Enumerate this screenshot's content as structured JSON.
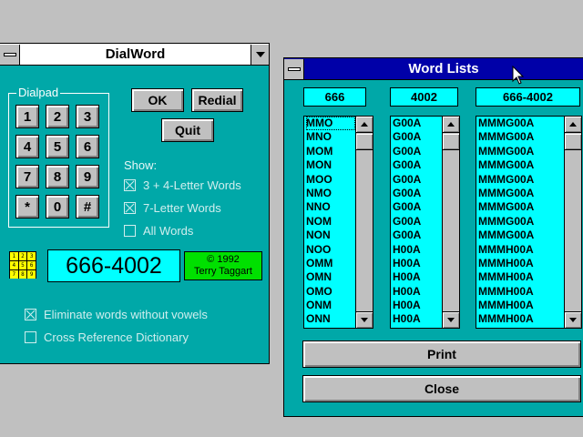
{
  "dialword": {
    "title": "DialWord",
    "dialpad_label": "Dialpad",
    "keys": [
      "1",
      "2",
      "3",
      "4",
      "5",
      "6",
      "7",
      "8",
      "9",
      "*",
      "0",
      "#"
    ],
    "buttons": {
      "ok": "OK",
      "redial": "Redial",
      "quit": "Quit"
    },
    "show_label": "Show:",
    "show_options": [
      {
        "label": "3 + 4-Letter Words",
        "checked": true
      },
      {
        "label": "7-Letter Words",
        "checked": true
      },
      {
        "label": "All Words",
        "checked": false
      }
    ],
    "keypad_icon_digits": [
      "1",
      "2",
      "3",
      "4",
      "5",
      "6",
      "7",
      "8",
      "9"
    ],
    "number": "666-4002",
    "copyright_line1": "© 1992",
    "copyright_line2": "Terry Taggart",
    "options": [
      {
        "label": "Eliminate words without vowels",
        "checked": true
      },
      {
        "label": "Cross Reference Dictionary",
        "checked": false
      }
    ]
  },
  "wordlists": {
    "title": "Word Lists",
    "columns": [
      {
        "header": "666",
        "items": [
          "MMO",
          "MNO",
          "MOM",
          "MON",
          "MOO",
          "NMO",
          "NNO",
          "NOM",
          "NON",
          "NOO",
          "OMM",
          "OMN",
          "OMO",
          "ONM",
          "ONN"
        ]
      },
      {
        "header": "4002",
        "items": [
          "G00A",
          "G00A",
          "G00A",
          "G00A",
          "G00A",
          "G00A",
          "G00A",
          "G00A",
          "G00A",
          "H00A",
          "H00A",
          "H00A",
          "H00A",
          "H00A",
          "H00A"
        ]
      },
      {
        "header": "666-4002",
        "items": [
          "MMMG00A",
          "MMMG00A",
          "MMMG00A",
          "MMMG00A",
          "MMMG00A",
          "MMMG00A",
          "MMMG00A",
          "MMMG00A",
          "MMMG00A",
          "MMMH00A",
          "MMMH00A",
          "MMMH00A",
          "MMMH00A",
          "MMMH00A",
          "MMMH00A"
        ]
      }
    ],
    "buttons": {
      "print": "Print",
      "close": "Close"
    }
  },
  "colors": {
    "window_bg": "#00a8a8",
    "field_bg": "#00ffff",
    "active_title": "#0000a8",
    "desktop": "#c0c0c0",
    "copyright_bg": "#00e000"
  }
}
